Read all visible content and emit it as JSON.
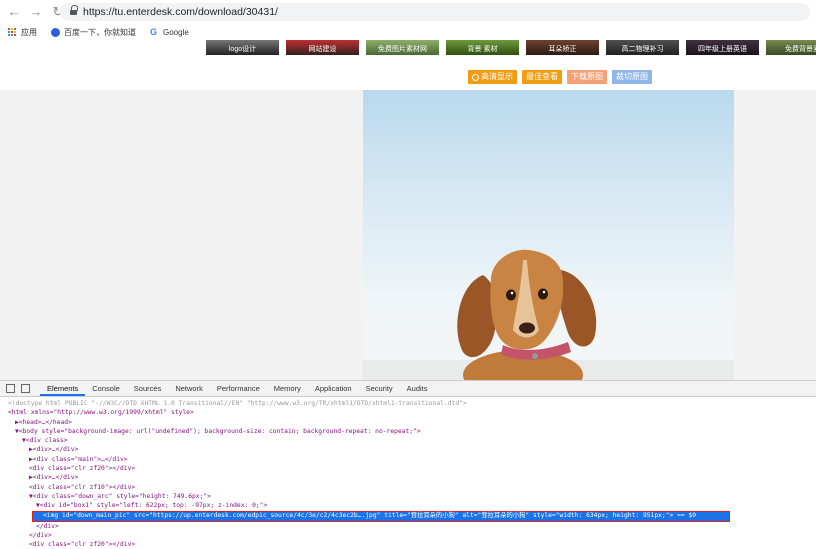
{
  "browser": {
    "url": "https://tu.enterdesk.com/download/30431/",
    "back_glyph": "←",
    "forward_glyph": "→",
    "reload_glyph": "↻",
    "bookmarks": [
      {
        "label": "应用",
        "icon": "apps-grid-icon"
      },
      {
        "label": "百度一下，你就知道",
        "icon": "baidu-icon"
      },
      {
        "label": "Google",
        "icon": "google-icon"
      }
    ]
  },
  "site": {
    "thumbnails": [
      "logo设计",
      "网站建设",
      "免费图片素材网",
      "背景 素材",
      "耳朵矫正",
      "高二物理补习",
      "四年级上册英语",
      "免费背景素"
    ],
    "actions": [
      {
        "label": "高清显示",
        "color": "#f39c12",
        "icon": "search-icon"
      },
      {
        "label": "最佳查看",
        "color": "#f39c12"
      },
      {
        "label": "下载原图",
        "color": "#f5a077"
      },
      {
        "label": "裁切原图",
        "color": "#8fb6e8"
      }
    ],
    "photo_subject": "puppy-photo"
  },
  "devtools": {
    "tabs": [
      "Elements",
      "Console",
      "Sources",
      "Network",
      "Performance",
      "Memory",
      "Application",
      "Security",
      "Audits"
    ],
    "active_tab": "Elements",
    "lines": [
      "<!doctype html PUBLIC \"-//W3C//DTD XHTML 1.0 Transitional//EN\" \"http://www.w3.org/TR/xhtml1/DTD/xhtml1-transitional.dtd\">",
      "<html xmlns=\"http://www.w3.org/1999/xhtml\" style>",
      "▶<head>…</head>",
      "▼<body style=\"background-image: url(\"undefined\"); background-size: contain; background-repeat: no-repeat;\">",
      "▼<div class>",
      "▶<div>…</div>",
      "▶<div class=\"main\">…</div>",
      "<div class=\"clr zf20\"></div>",
      "▶<div>…</div>",
      "<div class=\"clr zf10\"></div>",
      "▼<div class=\"down_arc\" style=\"height: 749.6px;\">",
      "▼<div id=\"box1\" style=\"left: 622px; top: -97px; z-index: 0;\">",
      "<img id=\"down_main_pic\" src=\"https://up.enterdesk.com/edpic_source/4c/3e/c2/4c3ec2b….jpg\" title=\"耷拉耳朵的小狗\" alt=\"耷拉耳朵的小狗\" style=\"width: 634px; height: 951px;\"> == $0",
      "</div>",
      "</div>",
      "<div class=\"clr zf20\"></div>"
    ],
    "selected_line": 12,
    "indents": [
      0,
      0,
      1,
      1,
      2,
      3,
      3,
      3,
      3,
      3,
      3,
      4,
      5,
      4,
      3,
      3
    ]
  }
}
